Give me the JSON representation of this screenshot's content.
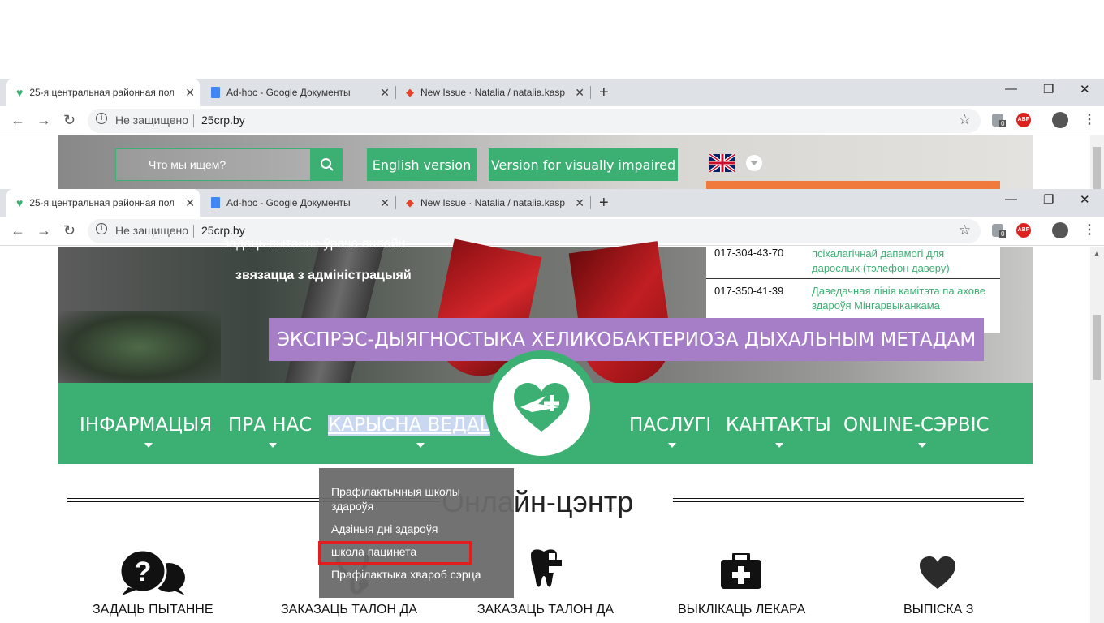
{
  "browser": {
    "tabs": [
      {
        "title": "25-я центральная районная пол"
      },
      {
        "title": "Ad-hoc - Google Документы"
      },
      {
        "title": "New Issue · Natalia / natalia.kasp"
      }
    ],
    "security_label": "Не защищено",
    "url": "25crp.by",
    "ext_badge": "0",
    "abp_label": "ABP"
  },
  "header": {
    "search_placeholder": "Что мы ищем?",
    "english_version": "English version",
    "impaired_version": "Version for visually impaired"
  },
  "hero": {
    "line_top": "задаць пытанне ўрача онлайн",
    "line_admin": "звязацца з адміністрацыяй",
    "banner": "ЭКСПРЭС-ДЫЯГНОСТЫКА ХЕЛИКОБАКТЕРИОЗА ДЫХАЛЬНЫМ МЕТАДАМ"
  },
  "hotlines": [
    {
      "phone": "017-304-43-70",
      "desc": "псіхалагічнай дапамогі для дарослых (тэлефон даверу)"
    },
    {
      "phone": "017-350-41-39",
      "desc": "Даведачная лінія камітэта па ахове здароўя Мінгарвыканкама"
    }
  ],
  "nav": {
    "items": [
      "ІНФАРМАЦЫЯ",
      "ПРА НАС",
      "КАРЫСНА ВЕДАЦЬ",
      "ПАСЛУГІ",
      "КАНТАКТЫ",
      "ONLINE-СЭРВІС"
    ]
  },
  "dropdown": {
    "items": [
      "Прафілактычныя школы здароўя",
      "Адзіныя дні здароўя",
      "школа пацинета",
      "Прафілактыка хвароб сэрца"
    ]
  },
  "online_center": {
    "title": "Онлайн-цэнтр",
    "services": [
      {
        "label": "ЗАДАЦЬ ПЫТАННЕ",
        "icon": "question-chat-icon"
      },
      {
        "label": "ЗАКАЗАЦЬ ТАЛОН ДА",
        "icon": "stethoscope-icon"
      },
      {
        "label": "ЗАКАЗАЦЬ ТАЛОН ДА",
        "icon": "tooth-icon"
      },
      {
        "label": "ВЫКЛІКАЦЬ ЛЕКАРА",
        "icon": "medical-kit-icon"
      },
      {
        "label": "ВЫПІСКА З",
        "icon": "heart-icon"
      }
    ]
  },
  "colors": {
    "green": "#3cb073",
    "purple": "#a67ec8",
    "orange": "#f07a3b",
    "highlight": "#e21d1d"
  }
}
